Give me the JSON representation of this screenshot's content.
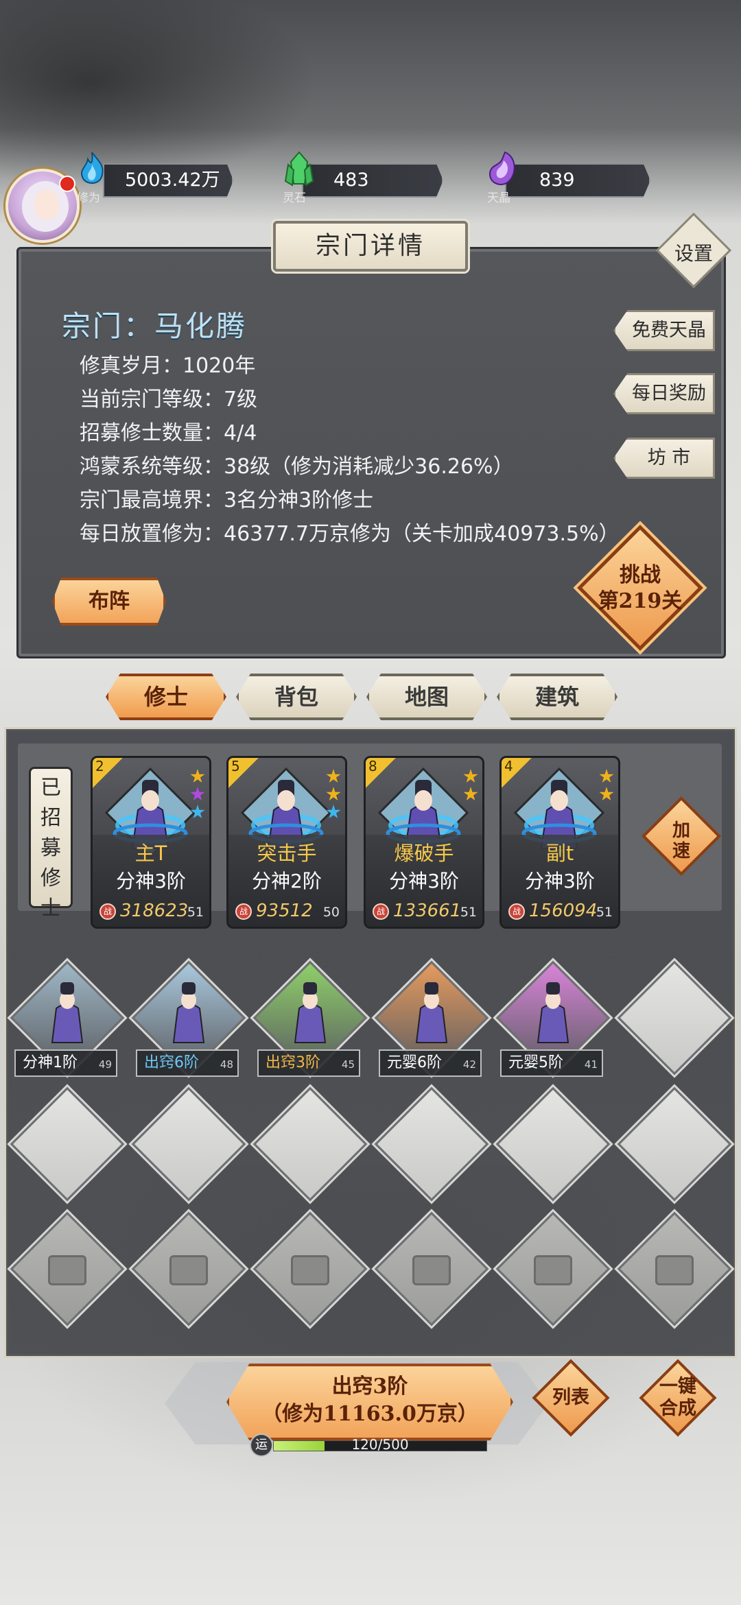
{
  "resources": [
    {
      "label": "修为",
      "value": "5003.42万京",
      "color": "#2aa6e6",
      "icon": "blue-flame-icon"
    },
    {
      "label": "灵石",
      "value": "483",
      "color": "#4fd06a",
      "icon": "green-crystal-icon"
    },
    {
      "label": "天晶",
      "value": "839",
      "color": "#9c5ad8",
      "icon": "purple-crystal-icon"
    }
  ],
  "panel": {
    "title": "宗门详情",
    "settings": "设置",
    "sect_name": "宗门：马化腾",
    "info": [
      "修真岁月：1020年",
      "当前宗门等级：7级",
      "招募修士数量：4/4",
      "鸿蒙系统等级：38级（修为消耗减少36.26%）",
      "宗门最高境界：3名分神3阶修士",
      "每日放置修为：46377.7万京修为（关卡加成40973.5%）"
    ],
    "side_buttons": [
      "免费天晶",
      "每日奖励",
      "坊 市"
    ],
    "formation": "布阵",
    "challenge_line1": "挑战",
    "challenge_line2": "第219关"
  },
  "tabs": [
    "修士",
    "背包",
    "地图",
    "建筑"
  ],
  "recruited_label": "已招募修士",
  "speed_up": "加速",
  "cards": [
    {
      "slot": "2",
      "name": "主T",
      "realm": "分神3阶",
      "power": "318623",
      "level": "51",
      "stars": [
        "#f0b21a",
        "#b04ae0",
        "#3fb6ef"
      ]
    },
    {
      "slot": "5",
      "name": "突击手",
      "realm": "分神2阶",
      "power": "93512",
      "level": "50",
      "stars": [
        "#f0b21a",
        "#f0b21a",
        "#3fb6ef"
      ]
    },
    {
      "slot": "8",
      "name": "爆破手",
      "realm": "分神3阶",
      "power": "133661",
      "level": "51",
      "stars": [
        "#f0b21a",
        "#f0b21a"
      ]
    },
    {
      "slot": "4",
      "name": "副t",
      "realm": "分神3阶",
      "power": "156094",
      "level": "51",
      "stars": [
        "#f0b21a",
        "#f0b21a"
      ]
    }
  ],
  "power_badge": "战",
  "grid_row1": [
    {
      "tag": "分神1阶",
      "level": "49",
      "tag_color": "#ffffff",
      "tile": "#9fb7c6"
    },
    {
      "tag": "出窍6阶",
      "level": "48",
      "tag_color": "#6ec8f5",
      "tile": "#a9c8dd"
    },
    {
      "tag": "出窍3阶",
      "level": "45",
      "tag_color": "#f3b74a",
      "tile": "#8fcf6a"
    },
    {
      "tag": "元婴6阶",
      "level": "42",
      "tag_color": "#ffffff",
      "tile": "#e59a5e"
    },
    {
      "tag": "元婴5阶",
      "level": "41",
      "tag_color": "#ffffff",
      "tile": "#d884d8"
    }
  ],
  "merge": {
    "line1": "出窍3阶",
    "line2": "（修为11163.0万京）"
  },
  "list_btn": "列表",
  "one_key_line1": "一键",
  "one_key_line2": "合成",
  "luck": {
    "label": "运",
    "text": "120/500",
    "value": 120,
    "max": 500
  }
}
